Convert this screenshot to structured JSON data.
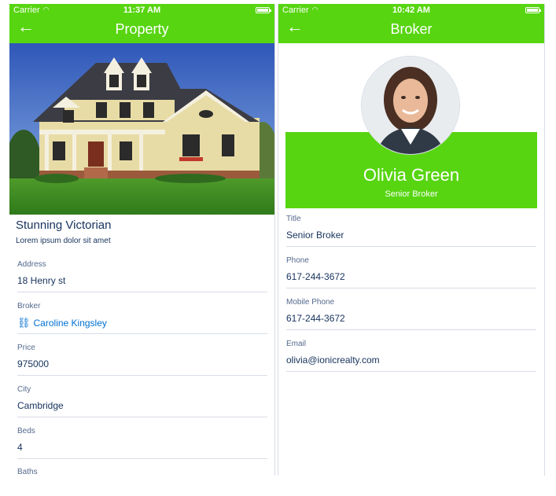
{
  "property_screen": {
    "status": {
      "carrier": "Carrier",
      "time": "11:37 AM"
    },
    "nav": {
      "title": "Property",
      "back_icon": "back-arrow-icon"
    },
    "title": "Stunning Victorian",
    "subtitle": "Lorem ipsum dolor sit amet",
    "fields": [
      {
        "label": "Address",
        "value": "18 Henry st"
      },
      {
        "label": "Broker",
        "value": "Caroline Kingsley",
        "link_icon": "link-icon"
      },
      {
        "label": "Price",
        "value": "975000"
      },
      {
        "label": "City",
        "value": "Cambridge"
      },
      {
        "label": "Beds",
        "value": "4"
      },
      {
        "label": "Baths",
        "value": ""
      }
    ]
  },
  "broker_screen": {
    "status": {
      "carrier": "Carrier",
      "time": "10:42 AM"
    },
    "nav": {
      "title": "Broker",
      "back_icon": "back-arrow-icon"
    },
    "name": "Olivia Green",
    "role": "Senior Broker",
    "fields": [
      {
        "label": "Title",
        "value": "Senior Broker"
      },
      {
        "label": "Phone",
        "value": "617-244-3672"
      },
      {
        "label": "Mobile Phone",
        "value": "617-244-3672"
      },
      {
        "label": "Email",
        "value": "olivia@ionicrealty.com"
      }
    ]
  },
  "colors": {
    "accent": "#57d511",
    "text": "#16325c",
    "label": "#54698d",
    "link": "#0070d2",
    "divider": "#d8dde6"
  }
}
